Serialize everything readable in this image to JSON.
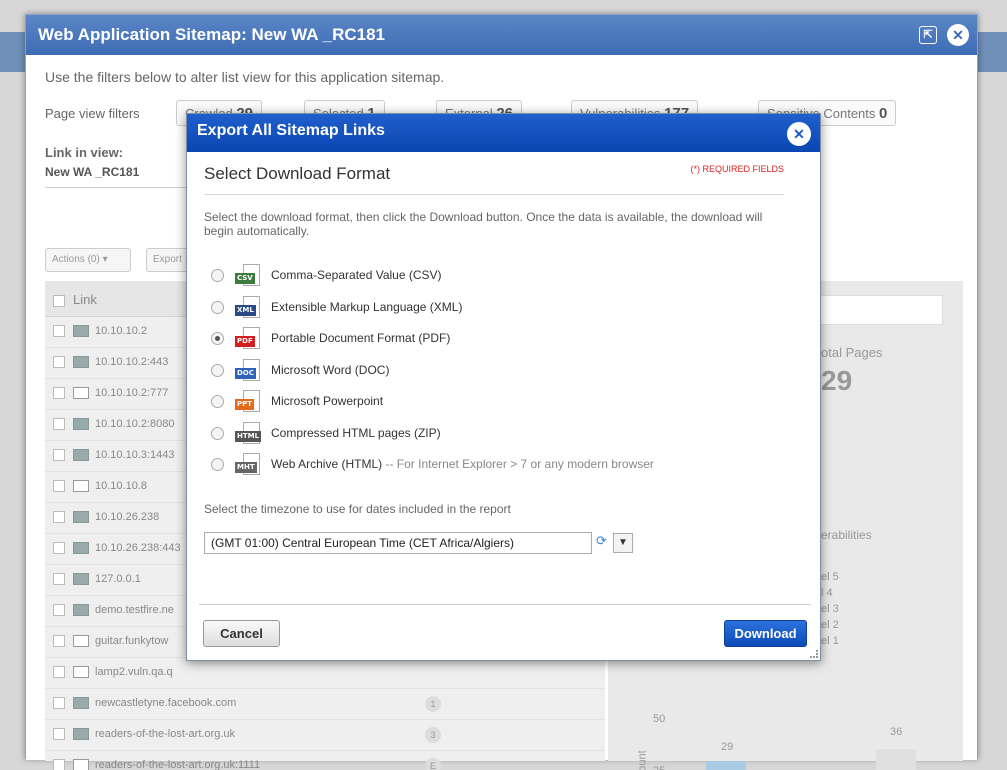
{
  "outer": {
    "title": "Web Application Sitemap: New WA _RC181",
    "description": "Use the filters below to alter list view for this application sitemap.",
    "filter_label": "Page view filters",
    "filters": [
      {
        "label": "Crawled",
        "count": "29"
      },
      {
        "label": "Selected",
        "count": "1"
      },
      {
        "label": "External",
        "count": "26"
      },
      {
        "label": "Vulnerabilities",
        "count": "177"
      },
      {
        "label": "Sensitive Contents",
        "count": "0"
      }
    ],
    "link_in_view_label": "Link in view:",
    "link_in_view_value": "New WA _RC181",
    "actions_label": "Actions (0)",
    "export_label": "Export",
    "list_header": "Link",
    "rows": [
      {
        "name": "10.10.10.2",
        "badge": ""
      },
      {
        "name": "10.10.10.2:443",
        "badge": ""
      },
      {
        "name": "10.10.10.2:777",
        "badge": ""
      },
      {
        "name": "10.10.10.2:8080",
        "badge": ""
      },
      {
        "name": "10.10.10.3:1443",
        "badge": ""
      },
      {
        "name": "10.10.10.8",
        "badge": ""
      },
      {
        "name": "10.10.26.238",
        "badge": ""
      },
      {
        "name": "10.10.26.238:443",
        "badge": ""
      },
      {
        "name": "127.0.0.1",
        "badge": ""
      },
      {
        "name": "demo.testfire.ne",
        "badge": ""
      },
      {
        "name": "guitar.funkytow",
        "badge": ""
      },
      {
        "name": "lamp2.vuln.qa.q",
        "badge": ""
      },
      {
        "name": "newcastletyne.facebook.com",
        "badge": "1"
      },
      {
        "name": "readers-of-the-lost-art.org.uk",
        "badge": "3"
      },
      {
        "name": "readers-of-the-lost-art.org.uk:1111",
        "badge": "E"
      }
    ],
    "total_pages_label": "otal Pages",
    "total_pages_value": "29",
    "vulnerabilities_label": "erabilities",
    "levels": [
      "el 5",
      "l 4",
      "el 3",
      "el 2",
      "el 1"
    ],
    "chart_ticks": [
      "50",
      "25"
    ],
    "chart_count_label": "Count",
    "chart_bar_labels": [
      "29",
      "36"
    ]
  },
  "modal": {
    "title": "Export All Sitemap Links",
    "section_title": "Select Download Format",
    "required_note": "(*) REQUIRED FIELDS",
    "instructions": "Select the download format, then click the Download button. Once the data is available, the download will begin automatically.",
    "formats": [
      {
        "icon": "CSV",
        "color": "#3d7a3d",
        "label": "Comma-Separated Value (CSV)",
        "note": "",
        "selected": false
      },
      {
        "icon": "XML",
        "color": "#2a4a86",
        "label": "Extensible Markup Language (XML)",
        "note": "",
        "selected": false
      },
      {
        "icon": "PDF",
        "color": "#d21f1f",
        "label": "Portable Document Format (PDF)",
        "note": "",
        "selected": true
      },
      {
        "icon": "DOC",
        "color": "#2f62b9",
        "label": "Microsoft Word (DOC)",
        "note": "",
        "selected": false
      },
      {
        "icon": "PPT",
        "color": "#e26b1b",
        "label": "Microsoft Powerpoint",
        "note": "",
        "selected": false
      },
      {
        "icon": "HTML",
        "color": "#555555",
        "label": "Compressed HTML pages (ZIP)",
        "note": "",
        "selected": false
      },
      {
        "icon": "MHT",
        "color": "#666666",
        "label": "Web Archive (HTML)",
        "note": " -- For Internet Explorer > 7 or any modern browser",
        "selected": false
      }
    ],
    "timezone_label": "Select the timezone to use for dates included in the report",
    "timezone_value": "(GMT 01:00) Central European Time (CET Africa/Algiers)",
    "cancel_label": "Cancel",
    "download_label": "Download"
  }
}
